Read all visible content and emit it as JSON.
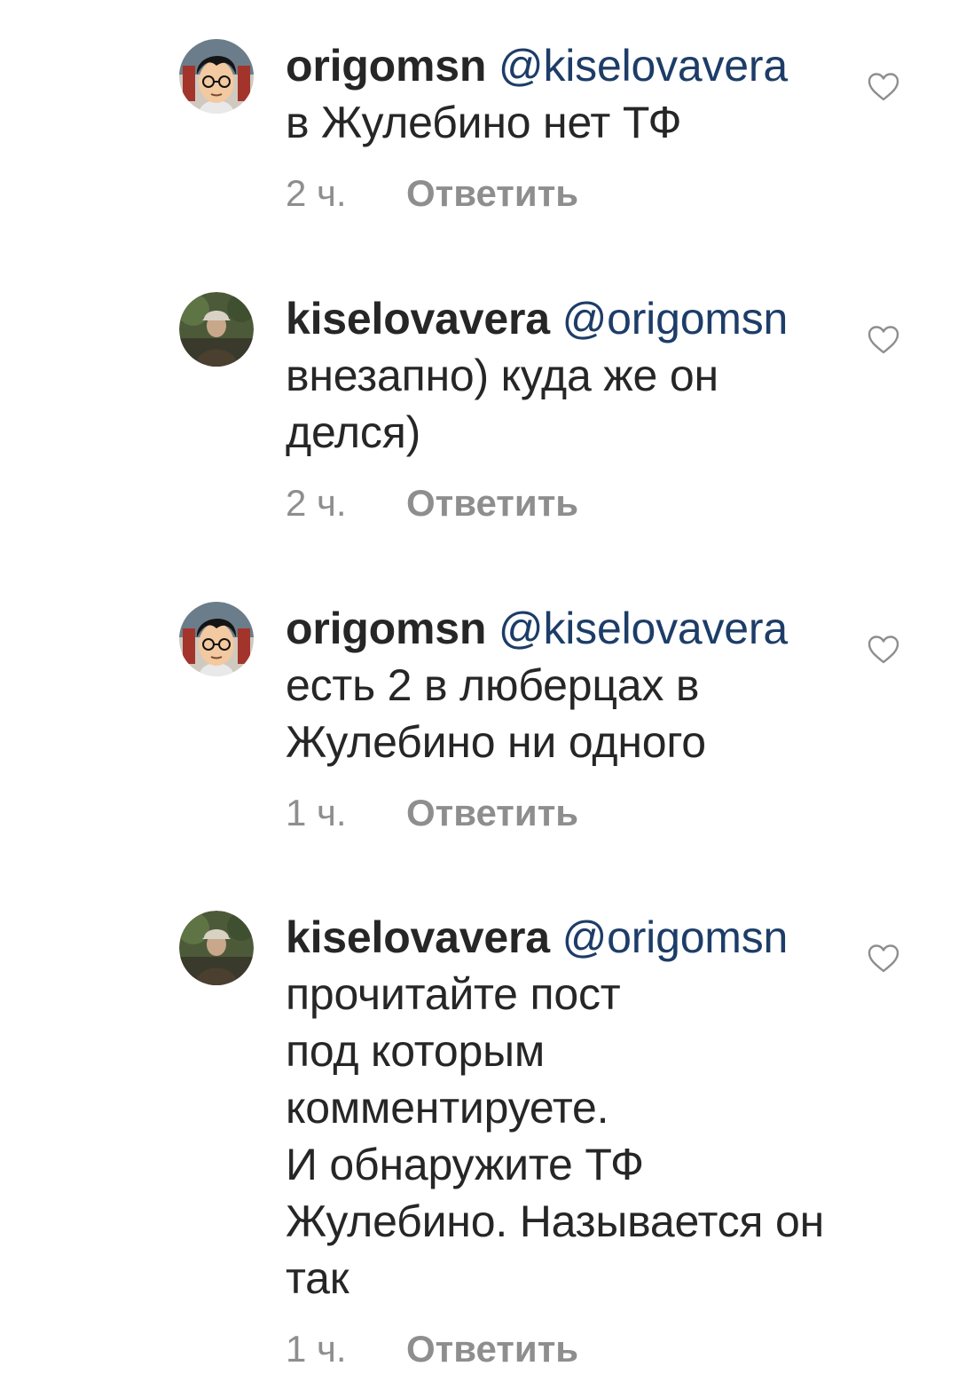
{
  "comments": [
    {
      "username": "origomsn",
      "mention": "@kiselovavera",
      "text": "в Жулебино нет ТФ",
      "time": "2 ч.",
      "reply_label": "Ответить",
      "avatar": "cartoon-avatar-glasses",
      "like_icon": "heart-outline-icon"
    },
    {
      "username": "kiselovavera",
      "mention": "@origomsn",
      "text": "внезапно) куда же он делся)",
      "time": "2 ч.",
      "reply_label": "Ответить",
      "avatar": "photo-avatar-person-cap",
      "like_icon": "heart-outline-icon"
    },
    {
      "username": "origomsn",
      "mention": "@kiselovavera",
      "text": "есть 2 в люберцах в Жулебино ни одного",
      "time": "1 ч.",
      "reply_label": "Ответить",
      "avatar": "cartoon-avatar-glasses",
      "like_icon": "heart-outline-icon"
    },
    {
      "username": "kiselovavera",
      "mention": "@origomsn",
      "text": "прочитайте пост\nпод которым\nкомментируете.\nИ обнаружите ТФ Жулебино. Называется он так",
      "time": "1 ч.",
      "reply_label": "Ответить",
      "avatar": "photo-avatar-person-cap",
      "like_icon": "heart-outline-icon"
    }
  ],
  "colors": {
    "text": "#262626",
    "mention": "#1d3d68",
    "muted": "#8e8e8e",
    "background": "#ffffff"
  }
}
